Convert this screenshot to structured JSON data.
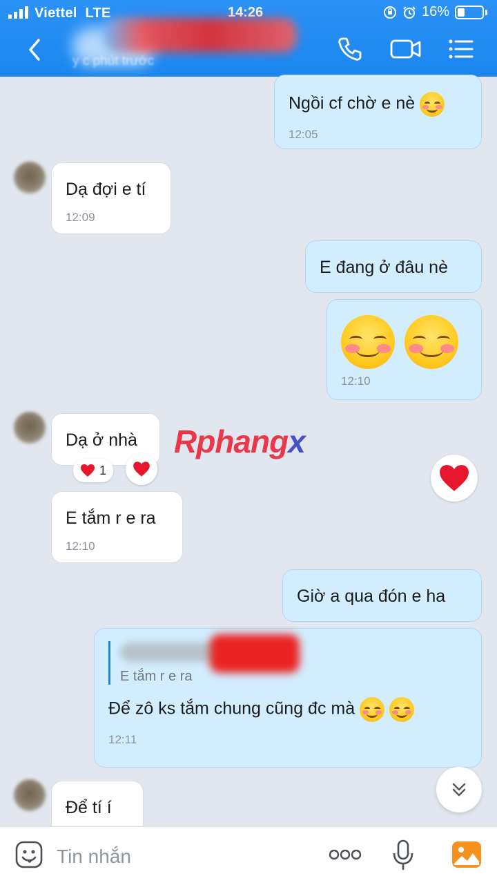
{
  "status_bar": {
    "carrier": "Viettel",
    "network": "LTE",
    "time": "14:26",
    "battery": "16%"
  },
  "header": {
    "subtitle": "y c    phút trước"
  },
  "messages": [
    {
      "text": "Ngồi cf chờ e nè",
      "time": "12:05"
    },
    {
      "text": "Dạ đợi e tí",
      "time": "12:09"
    },
    {
      "text": "E đang ở đâu nè"
    },
    {
      "time": "12:10"
    },
    {
      "text": "Dạ ở nhà"
    },
    {
      "text": "E tắm r e ra",
      "time": "12:10"
    },
    {
      "text": "Giờ a qua đón e ha"
    },
    {
      "quote": "E tắm r e ra",
      "text": "Để zô ks tắm chung cũng đc mà",
      "time": "12:11"
    },
    {
      "text": "Để tí í"
    }
  ],
  "reaction": {
    "count": "1"
  },
  "watermark": {
    "part1": "Rphang",
    "part2": "x"
  },
  "composer": {
    "placeholder": "Tin nhắn"
  },
  "colors": {
    "header": "#1a86ee",
    "outgoing_bubble": "#d2eefe",
    "incoming_bubble": "#ffffff",
    "background": "#e2e6ee"
  }
}
